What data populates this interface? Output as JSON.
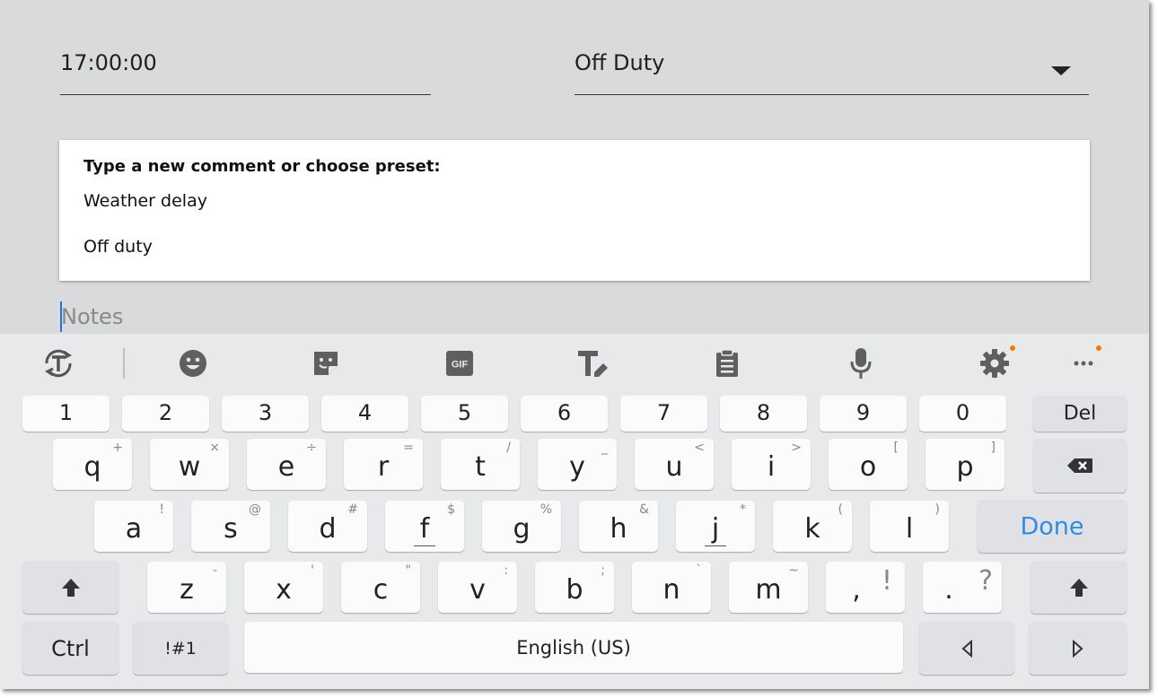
{
  "form": {
    "time_value": "17:00:00",
    "status_value": "Off Duty"
  },
  "comment_panel": {
    "title": "Type a new comment or choose preset:",
    "presets": [
      "Weather delay",
      "Off duty"
    ]
  },
  "notes": {
    "placeholder": "Notes"
  },
  "keyboard": {
    "toolbar_icons": [
      "text-translate-icon",
      "emoji-icon",
      "sticker-icon",
      "gif-icon",
      "text-style-icon",
      "clipboard-icon",
      "microphone-icon",
      "gear-icon",
      "more-icon"
    ],
    "gif_label": "GIF",
    "numbers": [
      "1",
      "2",
      "3",
      "4",
      "5",
      "6",
      "7",
      "8",
      "9",
      "0"
    ],
    "del_label": "Del",
    "row_q": [
      {
        "key": "q",
        "sup": "+"
      },
      {
        "key": "w",
        "sup": "×"
      },
      {
        "key": "e",
        "sup": "÷"
      },
      {
        "key": "r",
        "sup": "="
      },
      {
        "key": "t",
        "sup": "/"
      },
      {
        "key": "y",
        "sup": "_"
      },
      {
        "key": "u",
        "sup": "<"
      },
      {
        "key": "i",
        "sup": ">"
      },
      {
        "key": "o",
        "sup": "["
      },
      {
        "key": "p",
        "sup": "]"
      }
    ],
    "row_a": [
      {
        "key": "a",
        "sup": "!"
      },
      {
        "key": "s",
        "sup": "@"
      },
      {
        "key": "d",
        "sup": "#"
      },
      {
        "key": "f",
        "sup": "$"
      },
      {
        "key": "g",
        "sup": "%"
      },
      {
        "key": "h",
        "sup": "&"
      },
      {
        "key": "j",
        "sup": "*"
      },
      {
        "key": "k",
        "sup": "("
      },
      {
        "key": "l",
        "sup": ")"
      }
    ],
    "done_label": "Done",
    "row_z": [
      {
        "key": "z",
        "sup": "-"
      },
      {
        "key": "x",
        "sup": "'"
      },
      {
        "key": "c",
        "sup": "\""
      },
      {
        "key": "v",
        "sup": ":"
      },
      {
        "key": "b",
        "sup": ";"
      },
      {
        "key": "n",
        "sup": "`"
      },
      {
        "key": "m",
        "sup": "~"
      },
      {
        "key": ",",
        "sup": "!"
      },
      {
        "key": ".",
        "sup": "?"
      }
    ],
    "ctrl_label": "Ctrl",
    "symbols_label": "!#1",
    "space_label": "English (US)",
    "accent_color": "#2f8de4",
    "notification_dot_color": "#f57c00"
  }
}
